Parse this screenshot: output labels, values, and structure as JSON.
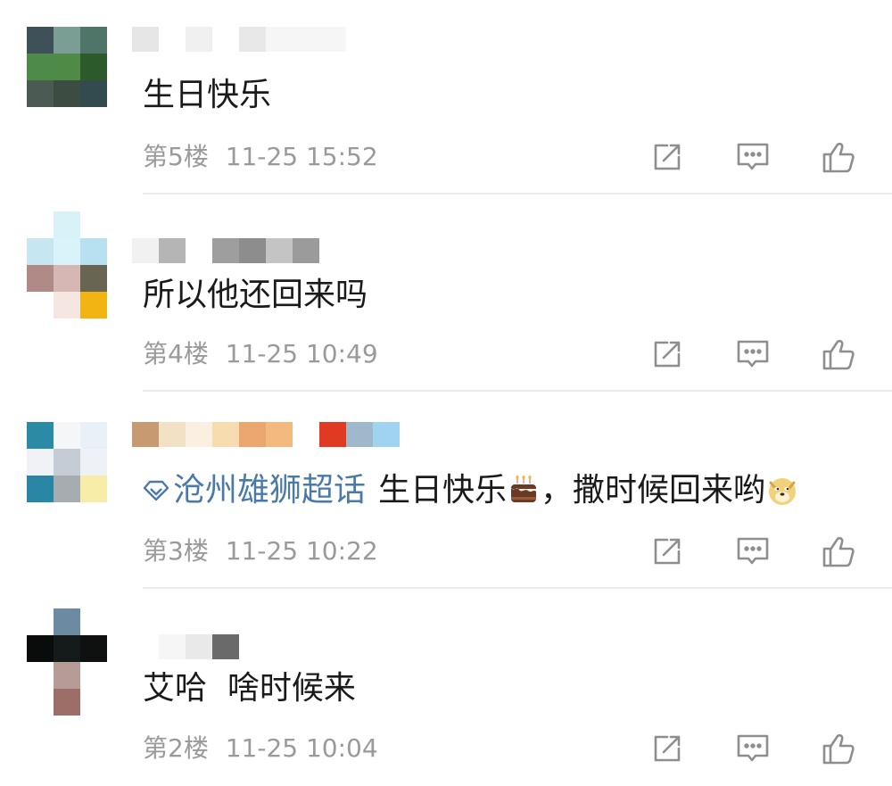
{
  "comments": [
    {
      "text": "生日快乐",
      "floor": "第5楼",
      "time": "11-25 15:52",
      "avatar_colors": [
        "#3e5058",
        "#7a9e94",
        "#4f7568",
        "#4e8a48",
        "#4f8a46",
        "#2d5a2a",
        "#4b5a52",
        "#3c4c43",
        "#334a4f"
      ],
      "name_blocks": [
        {
          "w": 30,
          "c": "#e6e6e6"
        },
        {
          "w": 30,
          "c": "#ffffff"
        },
        {
          "w": 30,
          "c": "#f0f0f0"
        },
        {
          "w": 30,
          "c": "#ffffff"
        },
        {
          "w": 30,
          "c": "#e8e8e8"
        },
        {
          "w": 90,
          "c": "#f6f6f6"
        }
      ]
    },
    {
      "text": "所以他还回来吗",
      "floor": "第4楼",
      "time": "11-25 10:49",
      "avatar_colors": [
        "#ffffff",
        "#d8f2f7",
        "#ffffff",
        "#c6e7f2",
        "#d9f3fa",
        "#b7e1f0",
        "#b08a86",
        "#d7b7b3",
        "#6a6452",
        "#ffffff",
        "#f6e6e2",
        "#f2b413"
      ],
      "name_blocks": [
        {
          "w": 30,
          "c": "#f1f1f1"
        },
        {
          "w": 30,
          "c": "#b5b5b5"
        },
        {
          "w": 30,
          "c": "#ffffff"
        },
        {
          "w": 30,
          "c": "#9e9e9e"
        },
        {
          "w": 30,
          "c": "#8d8d8d"
        },
        {
          "w": 30,
          "c": "#c4c4c4"
        },
        {
          "w": 30,
          "c": "#9b9b9b"
        }
      ]
    },
    {
      "topic": "沧州雄狮超话",
      "text_before": "生日快乐",
      "text_after": "，撒时候回来哟",
      "cake_emoji": "cake",
      "doge_emoji": "doge",
      "floor": "第3楼",
      "time": "11-25 10:22",
      "avatar_colors": [
        "#2b8aa6",
        "#f4f6f8",
        "#e9f1f6",
        "#f0f2f5",
        "#c6ccd6",
        "#eef2f6",
        "#2a86a5",
        "#a6acaf",
        "#f7eda8"
      ],
      "name_blocks": [
        {
          "w": 30,
          "c": "#c79a72"
        },
        {
          "w": 30,
          "c": "#f3e1c5"
        },
        {
          "w": 30,
          "c": "#fbefe2"
        },
        {
          "w": 30,
          "c": "#f7dcb0"
        },
        {
          "w": 30,
          "c": "#eca66f"
        },
        {
          "w": 30,
          "c": "#f3b97e"
        },
        {
          "w": 30,
          "c": "#ffffff"
        },
        {
          "w": 30,
          "c": "#e03a23"
        },
        {
          "w": 30,
          "c": "#9fb8cc"
        },
        {
          "w": 30,
          "c": "#9fd3f0"
        }
      ]
    },
    {
      "text": "艾哈  啥时候来",
      "floor": "第2楼",
      "time": "11-25 10:04",
      "avatar_colors": [
        "#ffffff",
        "#6c8ba2",
        "#ffffff",
        "#0a0c0c",
        "#151a1a",
        "#0f1010",
        "#ffffff",
        "#b69b96",
        "#ffffff",
        "#ffffff",
        "#9d6e68",
        "#ffffff"
      ],
      "name_blocks": [
        {
          "w": 30,
          "c": "#ffffff"
        },
        {
          "w": 30,
          "c": "#f6f6f6"
        },
        {
          "w": 30,
          "c": "#e9e9e9"
        },
        {
          "w": 30,
          "c": "#6a6a6a"
        }
      ]
    }
  ],
  "actions": [
    {
      "name": "forward",
      "icon": "share-icon"
    },
    {
      "name": "comment",
      "icon": "comment-icon"
    },
    {
      "name": "like",
      "icon": "like-icon"
    }
  ]
}
